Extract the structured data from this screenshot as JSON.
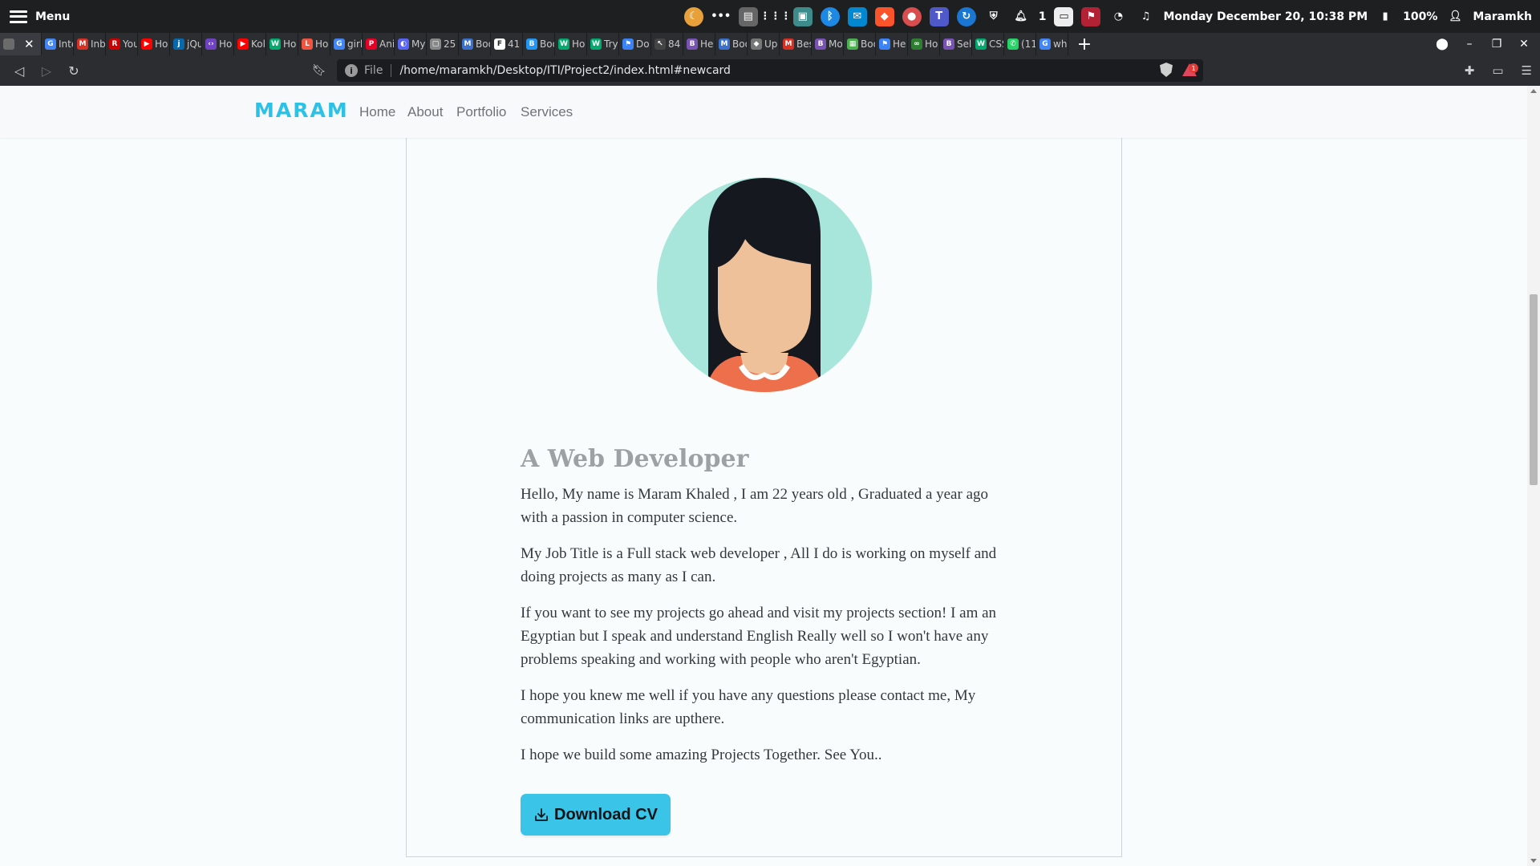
{
  "system_panel": {
    "menu_label": "Menu",
    "workspace_count": "1",
    "datetime": "Monday December 20, 10:38 PM",
    "battery": "100%",
    "username": "Maramkh"
  },
  "tabs": [
    {
      "label": "",
      "icon": "brave-icon",
      "color": "#6b6b6b",
      "glyph": ""
    },
    {
      "label": "Inte",
      "icon": "google-icon",
      "color": "#4285f4",
      "glyph": "G"
    },
    {
      "label": "Inb",
      "icon": "gmail-icon",
      "color": "#d93025",
      "glyph": "M"
    },
    {
      "label": "You",
      "icon": "redhat-icon",
      "color": "#cc0000",
      "glyph": "R"
    },
    {
      "label": "Ho",
      "icon": "youtube-icon",
      "color": "#ff0000",
      "glyph": "▶"
    },
    {
      "label": "jQu",
      "icon": "jquery-icon",
      "color": "#0769ad",
      "glyph": "j"
    },
    {
      "label": "Ho",
      "icon": "code-icon",
      "color": "#6f42c1",
      "glyph": "‹›"
    },
    {
      "label": "Kol",
      "icon": "youtube-icon",
      "color": "#ff0000",
      "glyph": "▶"
    },
    {
      "label": "Ho",
      "icon": "w3schools-icon",
      "color": "#04aa6d",
      "glyph": "W"
    },
    {
      "label": "Ho",
      "icon": "laravel-icon",
      "color": "#f05340",
      "glyph": "L"
    },
    {
      "label": "girl",
      "icon": "google-icon",
      "color": "#4285f4",
      "glyph": "G"
    },
    {
      "label": "Ani",
      "icon": "pinterest-icon",
      "color": "#e60023",
      "glyph": "P"
    },
    {
      "label": "My",
      "icon": "chat-icon",
      "color": "#5865f2",
      "glyph": "◐"
    },
    {
      "label": "25",
      "icon": "doc-icon",
      "color": "#888888",
      "glyph": "▢"
    },
    {
      "label": "Boo",
      "icon": "mdb-icon",
      "color": "#3b71ca",
      "glyph": "M"
    },
    {
      "label": "41",
      "icon": "frame-icon",
      "color": "#ffffff",
      "glyph": "F"
    },
    {
      "label": "Boo",
      "icon": "bootsnipp-icon",
      "color": "#2196f3",
      "glyph": "B"
    },
    {
      "label": "Ho",
      "icon": "w3schools-icon",
      "color": "#04aa6d",
      "glyph": "W"
    },
    {
      "label": "Try",
      "icon": "w3schools-icon",
      "color": "#04aa6d",
      "glyph": "W"
    },
    {
      "label": "Do",
      "icon": "flag-icon",
      "color": "#3b82f6",
      "glyph": "⚑"
    },
    {
      "label": "84",
      "icon": "cursor-icon",
      "color": "#444444",
      "glyph": "↖"
    },
    {
      "label": "He",
      "icon": "bootstrap-icon",
      "color": "#7952b3",
      "glyph": "B"
    },
    {
      "label": "Boo",
      "icon": "mdb-icon",
      "color": "#3b71ca",
      "glyph": "M"
    },
    {
      "label": "Up",
      "icon": "layers-icon",
      "color": "#777777",
      "glyph": "◆"
    },
    {
      "label": "Bes",
      "icon": "gmail-icon",
      "color": "#d93025",
      "glyph": "M"
    },
    {
      "label": "Mo",
      "icon": "bootstrap-icon",
      "color": "#7952b3",
      "glyph": "B"
    },
    {
      "label": "Boo",
      "icon": "image-icon",
      "color": "#4caf50",
      "glyph": "▦"
    },
    {
      "label": "He",
      "icon": "flag-icon",
      "color": "#3b82f6",
      "glyph": "⚑"
    },
    {
      "label": "Ho",
      "icon": "link-icon",
      "color": "#2e7d32",
      "glyph": "∞"
    },
    {
      "label": "Sel",
      "icon": "bootstrap-icon",
      "color": "#7952b3",
      "glyph": "B"
    },
    {
      "label": "CSS",
      "icon": "w3schools-icon",
      "color": "#04aa6d",
      "glyph": "W"
    },
    {
      "label": "(11",
      "icon": "whatsapp-icon",
      "color": "#25d366",
      "glyph": "✆"
    },
    {
      "label": "wh",
      "icon": "google-icon",
      "color": "#4285f4",
      "glyph": "G"
    }
  ],
  "address_bar": {
    "scheme_label": "File",
    "url": "/home/maramkh/Desktop/ITI/Project2/index.html#newcard",
    "rewards_badge": "1"
  },
  "site": {
    "brand": "MARAM",
    "nav": [
      "Home",
      "About",
      "Portfolio",
      "Services"
    ],
    "heading": "A Web Developer",
    "paragraphs": [
      "Hello, My name is Maram Khaled , I am 22 years old , Graduated a year ago with a passion in computer science.",
      "My Job Title is a Full stack web developer , All I do is working on myself and doing projects as many as I can.",
      "If you want to see my projects go ahead and visit my projects section! I am an Egyptian but I speak and understand English Really well so I won't have any problems speaking and working with people who aren't Egyptian.",
      "I hope you knew me well if you have any questions please contact me, My communication links are upthere.",
      "I hope we build some amazing Projects Together. See You.."
    ],
    "cv_button": "Download CV"
  },
  "colors": {
    "brand": "#2cc1e6",
    "button": "#39c4e8",
    "avatar_bg": "#a8e6dc",
    "hair": "#15191f",
    "skin": "#efc19a",
    "shirt": "#ee6f4b"
  }
}
